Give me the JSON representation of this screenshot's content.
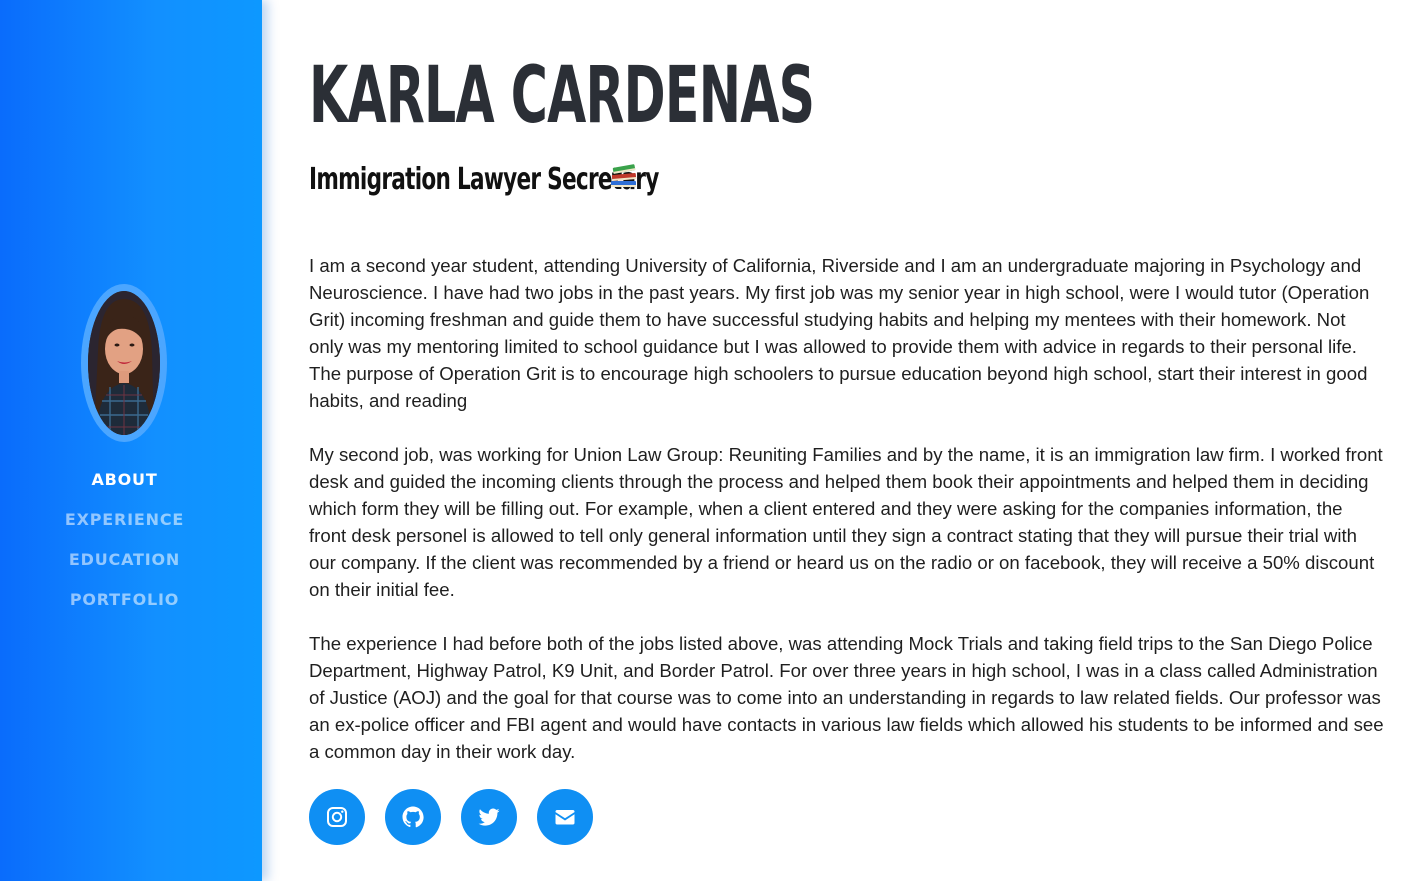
{
  "profile": {
    "name": "KARLA CARDENAS",
    "subtitle": "Immigration Lawyer Secretary",
    "subtitle_icon": "books-emoji-icon"
  },
  "sidebar": {
    "avatar_alt": "Profile photo",
    "nav": [
      {
        "label": "ABOUT",
        "active": true
      },
      {
        "label": "EXPERIENCE",
        "active": false
      },
      {
        "label": "EDUCATION",
        "active": false
      },
      {
        "label": "PORTFOLIO",
        "active": false
      }
    ]
  },
  "bio": {
    "paragraphs": [
      "I am a second year student, attending University of California, Riverside and I am an undergraduate majoring in Psychology and Neuroscience. I have had two jobs in the past years. My first job was my senior year in high school, were I would tutor (Operation Grit) incoming freshman and guide them to have successful studying habits and helping my mentees with their homework. Not only was my mentoring limited to school guidance but I was allowed to provide them with advice in regards to their personal life. The purpose of Operation Grit is to encourage high schoolers to pursue education beyond high school, start their interest in good habits, and reading",
      "My second job, was working for Union Law Group: Reuniting Families and by the name, it is an immigration law firm. I worked front desk and guided the incoming clients through the process and helped them book their appointments and helped them in deciding which form they will be filling out. For example, when a client entered and they were asking for the companies information, the front desk personel is allowed to tell only general information until they sign a contract stating that they will pursue their trial with our company. If the client was recommended by a friend or heard us on the radio or on facebook, they will receive a 50% discount on their initial fee.",
      "The experience I had before both of the jobs listed above, was attending Mock Trials and taking field trips to the San Diego Police Department, Highway Patrol, K9 Unit, and Border Patrol. For over three years in high school, I was in a class called Administration of Justice (AOJ) and the goal for that course was to come into an understanding in regards to law related fields. Our professor was an ex-police officer and FBI agent and would have contacts in various law fields which allowed his students to be informed and see a common day in their work day."
    ]
  },
  "socials": [
    {
      "icon": "instagram-icon"
    },
    {
      "icon": "github-icon"
    },
    {
      "icon": "twitter-icon"
    },
    {
      "icon": "envelope-icon"
    }
  ],
  "colors": {
    "sidebar_start": "#0a6cfc",
    "sidebar_end": "#0d98ff",
    "social_button": "#0f8ff3",
    "heading": "#2b2f36",
    "nav_inactive": "rgba(255,255,255,0.55)"
  }
}
